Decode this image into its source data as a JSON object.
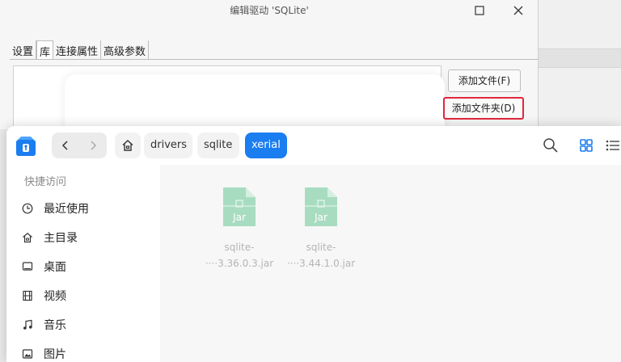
{
  "dialog": {
    "title": "编辑驱动 'SQLite'",
    "tabs": [
      {
        "label": "设置",
        "active": false
      },
      {
        "label": "库",
        "active": true
      },
      {
        "label": "连接属性",
        "active": false
      },
      {
        "label": "高级参数",
        "active": false
      }
    ],
    "buttons": {
      "add_file": "添加文件(F)",
      "add_folder": "添加文件夹(D)"
    },
    "window_controls": [
      "minimize-icon",
      "close-icon"
    ]
  },
  "file_chooser": {
    "breadcrumb": [
      {
        "label": "drivers",
        "active": false
      },
      {
        "label": "sqlite",
        "active": false
      },
      {
        "label": "xerial",
        "active": true
      }
    ],
    "sidebar": {
      "heading": "快捷访问",
      "items": [
        {
          "label": "最近使用",
          "icon": "clock-icon"
        },
        {
          "label": "主目录",
          "icon": "home-icon"
        },
        {
          "label": "桌面",
          "icon": "desktop-icon"
        },
        {
          "label": "视频",
          "icon": "video-icon"
        },
        {
          "label": "音乐",
          "icon": "music-icon"
        },
        {
          "label": "图片",
          "icon": "picture-icon"
        }
      ]
    },
    "files": [
      {
        "name_line1": "sqlite-",
        "name_line2": "····3.36.0.3.jar",
        "type_label": "Jar"
      },
      {
        "name_line1": "sqlite-",
        "name_line2": "····3.44.1.0.jar",
        "type_label": "Jar"
      }
    ]
  },
  "colors": {
    "accent": "#1a7df0",
    "highlight_border": "#e0283c",
    "jar_icon": "#a8dcc0"
  }
}
